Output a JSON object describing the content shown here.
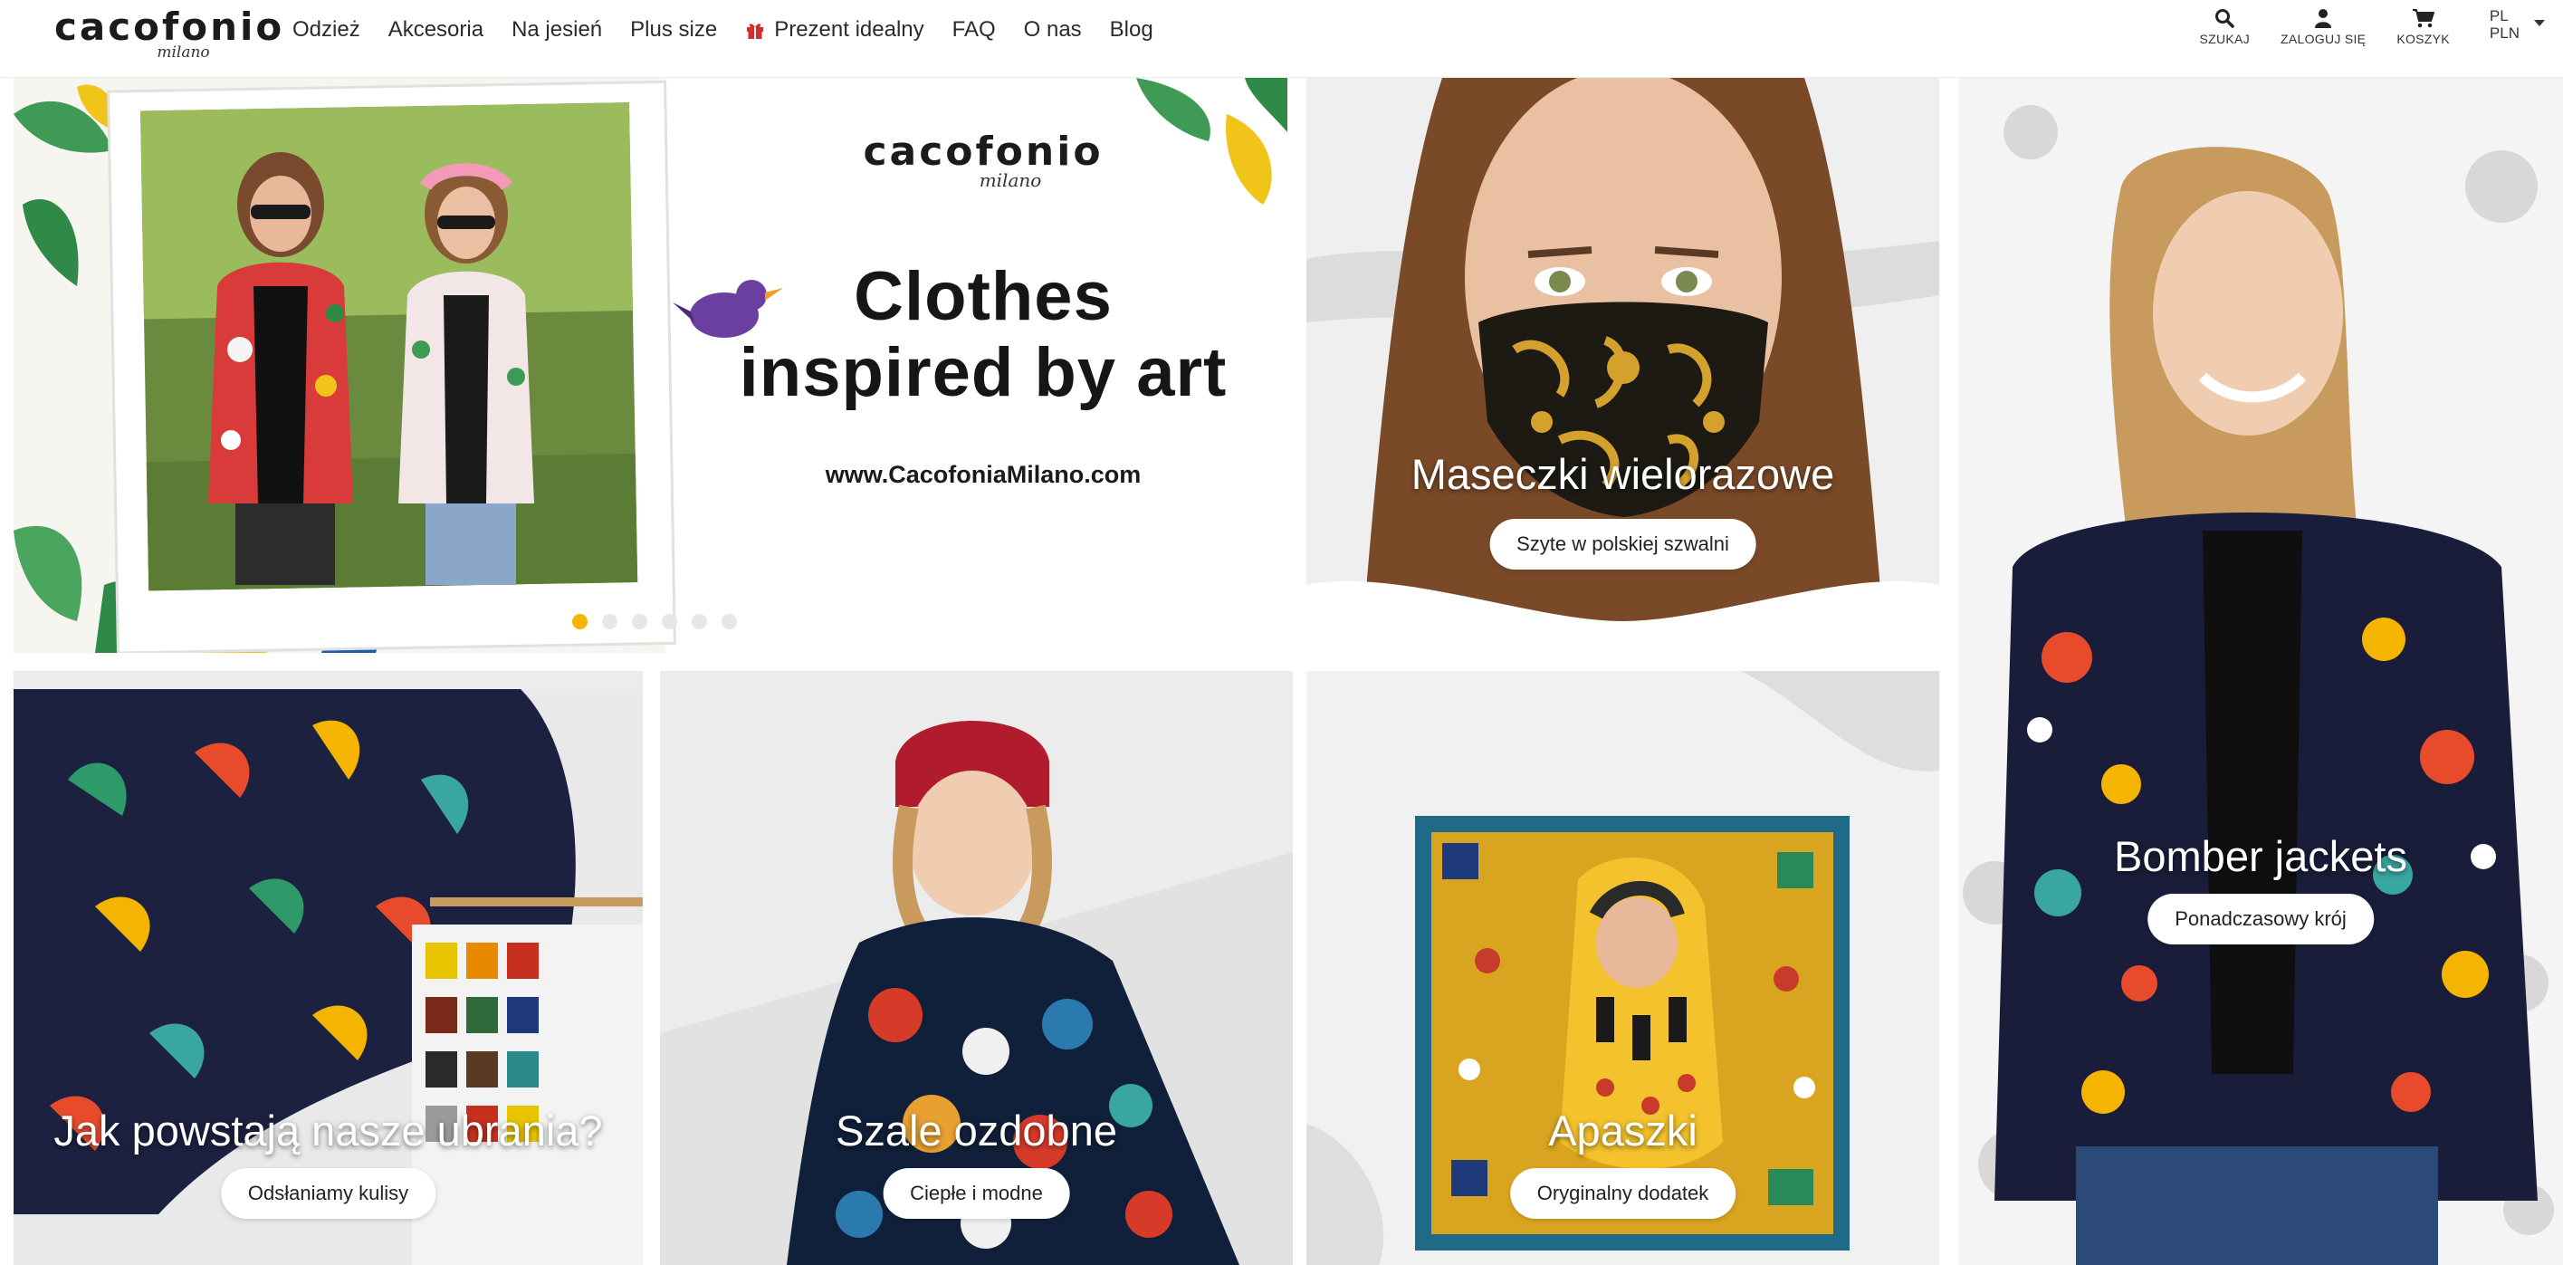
{
  "logo": {
    "main": "cacofonio",
    "sub": "milano"
  },
  "nav": {
    "items": [
      "Odzież",
      "Akcesoria",
      "Na jesień",
      "Plus size"
    ],
    "gift_label": "Prezent idealny",
    "items_after": [
      "FAQ",
      "O nas",
      "Blog"
    ]
  },
  "actions": {
    "search": "SZUKAJ",
    "login": "ZALOGUJ SIĘ",
    "cart": "KOSZYK",
    "lang": "PL",
    "currency": "PLN"
  },
  "banner": {
    "brand_main": "cacofonio",
    "brand_sub": "milano",
    "headline_1": "Clothes",
    "headline_2": "inspired by art",
    "url": "www.CacofoniaMilano.com",
    "slides": 6,
    "active_slide": 1
  },
  "tiles": {
    "masks": {
      "title": "Maseczki wielorazowe",
      "button": "Szyte w polskiej szwalni"
    },
    "bomber": {
      "title": "Bomber jackets",
      "button": "Ponadczasowy krój"
    },
    "making": {
      "title": "Jak powstają nasze ubrania?",
      "button": "Odsłaniamy kulisy"
    },
    "scarves": {
      "title": "Szale ozdobne",
      "button": "Ciepłe i modne"
    },
    "apaszki": {
      "title": "Apaszki",
      "button": "Oryginalny dodatek"
    }
  },
  "colors": {
    "accent": "#f5b400",
    "gift": "#d62b2b",
    "text": "#2b2b2b"
  }
}
